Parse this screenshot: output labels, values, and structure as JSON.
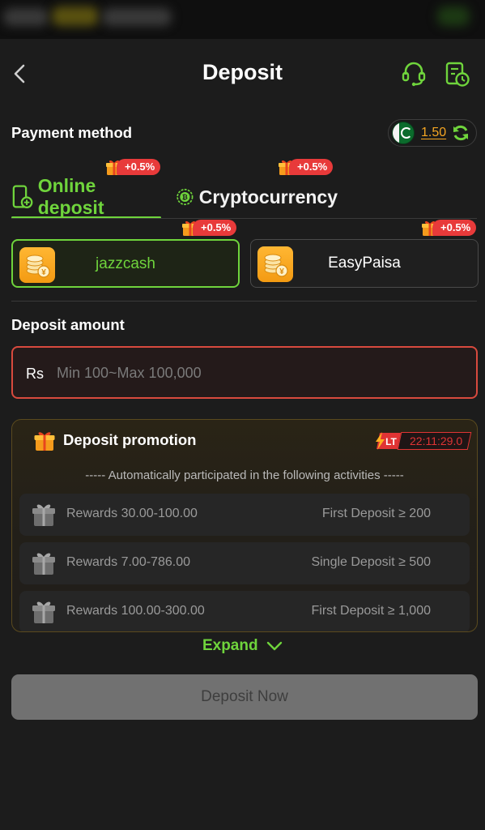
{
  "header": {
    "title": "Deposit"
  },
  "payment_method": {
    "label": "Payment method",
    "balance": "1.50",
    "tabs": [
      {
        "label": "Online deposit",
        "bonus": "+0.5%",
        "active": true
      },
      {
        "label": "Cryptocurrency",
        "bonus": "+0.5%",
        "active": false
      }
    ],
    "channels": [
      {
        "label": "jazzcash",
        "bonus": "+0.5%",
        "selected": true
      },
      {
        "label": "EasyPaisa",
        "bonus": "+0.5%",
        "selected": false
      }
    ]
  },
  "deposit_amount": {
    "label": "Deposit amount",
    "currency": "Rs",
    "placeholder": "Min 100~Max 100,000"
  },
  "promotion": {
    "title": "Deposit promotion",
    "lt_tag": "LT",
    "timer": "22:11:29.0",
    "subtitle": "----- Automatically participated in the following activities -----",
    "rows": [
      {
        "reward": "Rewards 30.00-100.00",
        "condition": "First Deposit ≥ 200"
      },
      {
        "reward": "Rewards 7.00-786.00",
        "condition": "Single Deposit ≥ 500"
      },
      {
        "reward": "Rewards 100.00-300.00",
        "condition": "First Deposit ≥ 1,000"
      }
    ]
  },
  "expand_label": "Expand",
  "submit_label": "Deposit Now",
  "colors": {
    "accent": "#6fd43c",
    "alert": "#e83a3a",
    "balance": "#f5a623"
  },
  "icons": [
    "back-arrow-icon",
    "support-headset-icon",
    "deposit-history-icon",
    "pakistan-flag-icon",
    "refresh-icon",
    "gift-icon",
    "phone-deposit-icon",
    "crypto-coin-icon",
    "coin-stack-icon",
    "lightning-icon",
    "chevron-down-icon"
  ]
}
